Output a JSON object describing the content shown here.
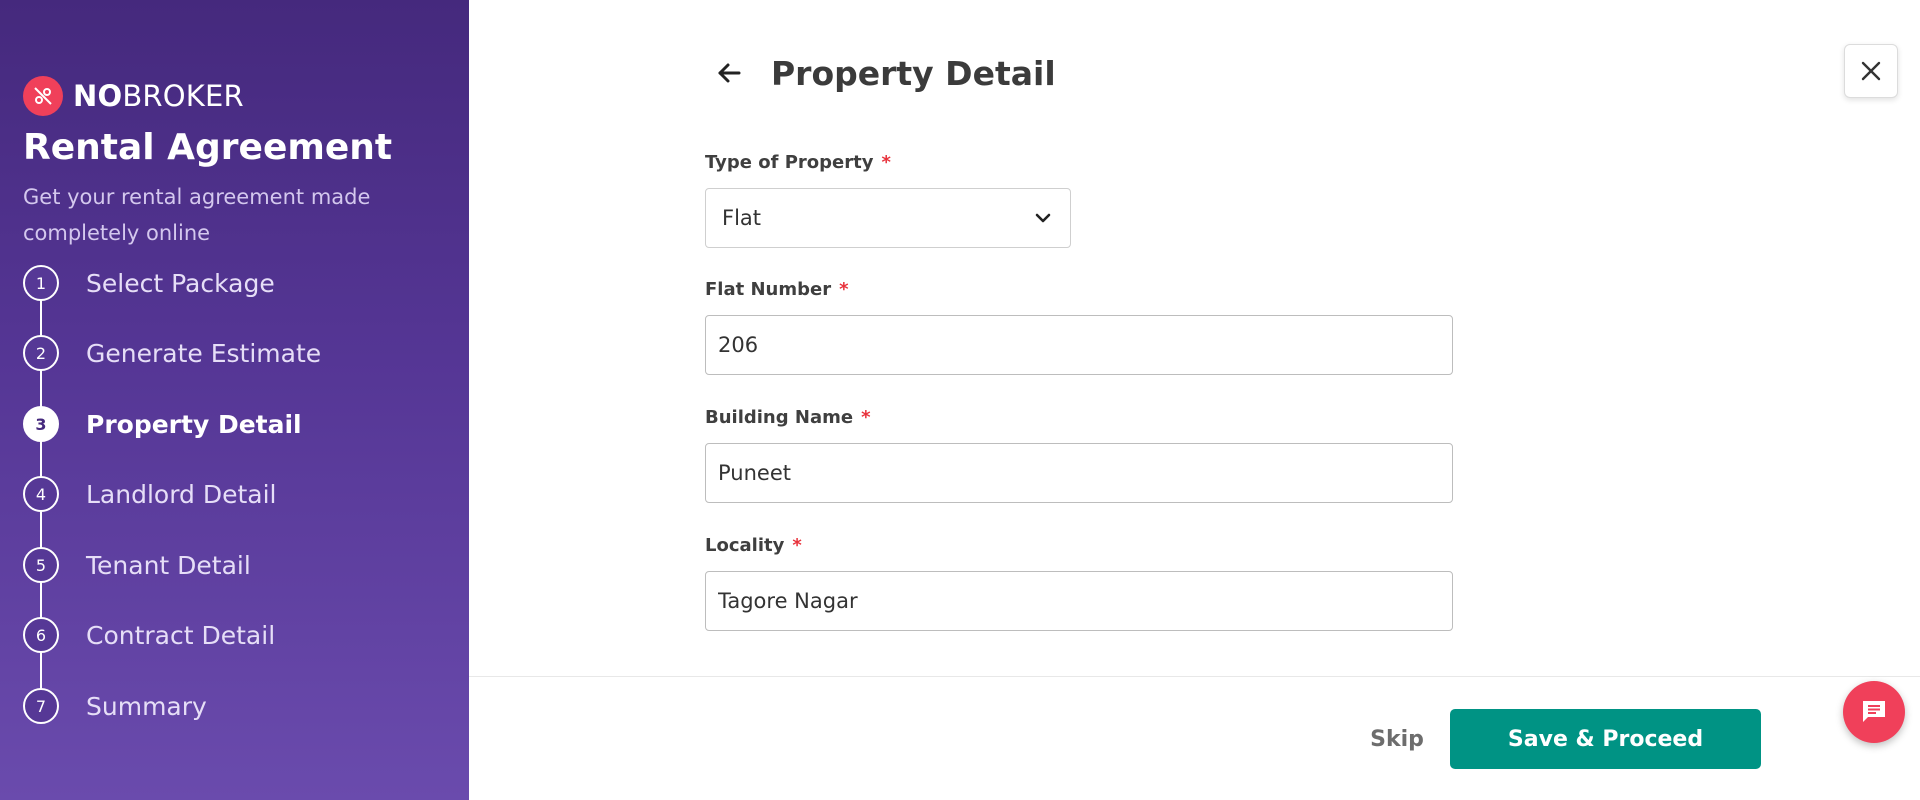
{
  "brand": {
    "name_bold": "NO",
    "name_regular": "BROKER",
    "logo_icon": "nobroker-logo-icon",
    "accent_color": "#f0405a"
  },
  "sidebar": {
    "title": "Rental Agreement",
    "subtitle": "Get your rental agreement made completely online",
    "steps": [
      {
        "number": "1",
        "label": "Select Package",
        "active": false
      },
      {
        "number": "2",
        "label": "Generate Estimate",
        "active": false
      },
      {
        "number": "3",
        "label": "Property Detail",
        "active": true
      },
      {
        "number": "4",
        "label": "Landlord Detail",
        "active": false
      },
      {
        "number": "5",
        "label": "Tenant Detail",
        "active": false
      },
      {
        "number": "6",
        "label": "Contract Detail",
        "active": false
      },
      {
        "number": "7",
        "label": "Summary",
        "active": false
      }
    ]
  },
  "header": {
    "back_icon": "arrow-left-icon",
    "title": "Property Detail",
    "close_icon": "close-icon"
  },
  "form": {
    "required_mark": "*",
    "type_of_property": {
      "label": "Type of Property",
      "value": "Flat",
      "icon": "chevron-down-icon"
    },
    "flat_number": {
      "label": "Flat Number",
      "value": "206"
    },
    "building_name": {
      "label": "Building Name",
      "value": "Puneet"
    },
    "locality": {
      "label": "Locality",
      "value": "Tagore Nagar"
    }
  },
  "footer": {
    "skip_label": "Skip",
    "save_label": "Save & Proceed",
    "save_color": "#009384",
    "chat_icon": "chat-icon"
  }
}
